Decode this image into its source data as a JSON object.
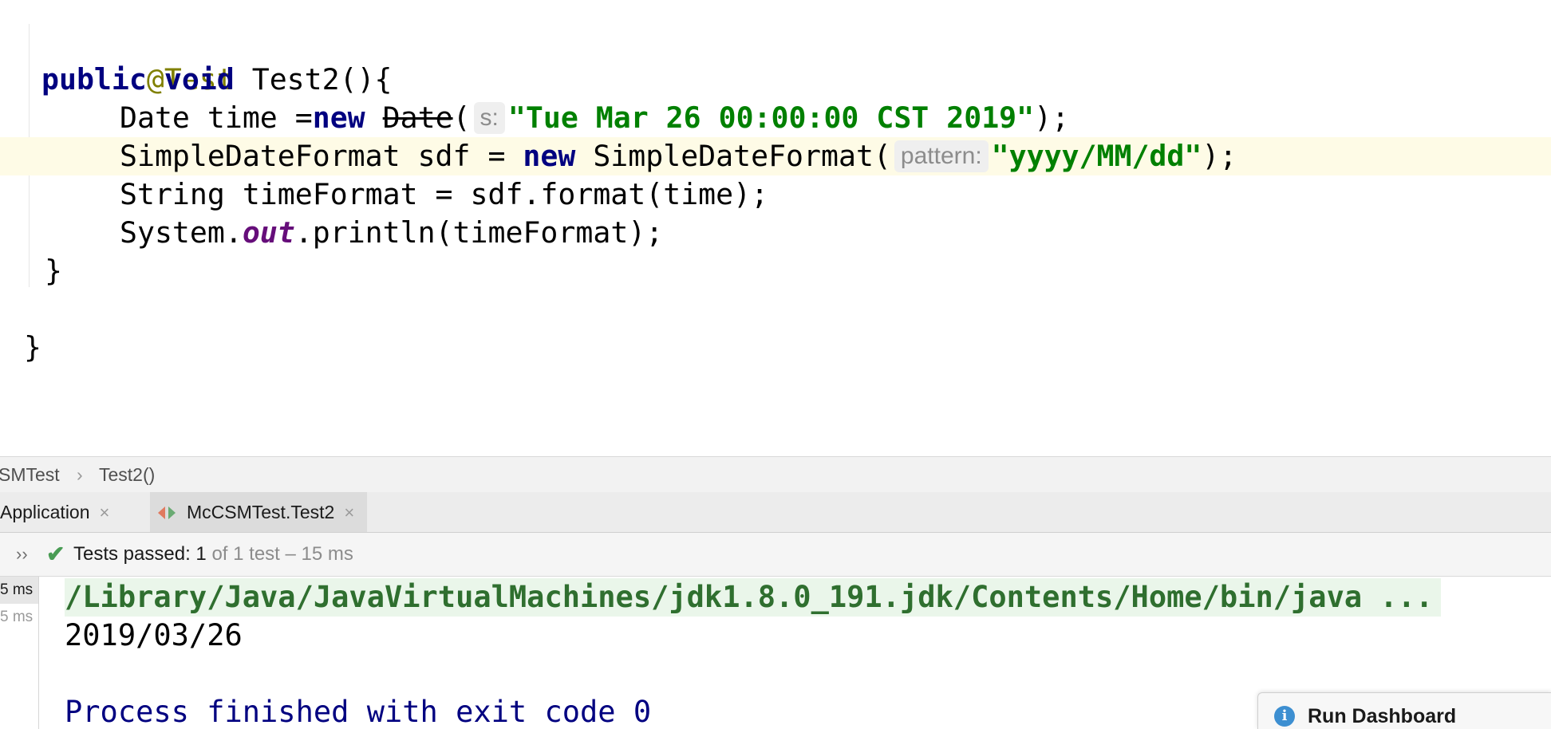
{
  "editor": {
    "annotation": "@Test",
    "method_kw_public": "public",
    "method_kw_void": "void",
    "method_sig": " Test2(){",
    "line3": {
      "prefix": "Date time =",
      "kw_new": "new",
      "deprecated_ctor": "Date",
      "paren": "(",
      "hint": "s:",
      "string": "\"Tue Mar 26 00:00:00 CST 2019\"",
      "suffix": ");"
    },
    "line4": {
      "prefix": "SimpleDateFormat sdf = ",
      "kw_new": "new",
      "ctor": " SimpleDateFormat(",
      "hint": "pattern:",
      "string": "\"yyyy/MM/dd\"",
      "suffix": ");"
    },
    "line5": "String timeFormat = sdf.format(time);",
    "line6": {
      "prefix": "System.",
      "field": "out",
      "suffix": ".println(timeFormat);"
    },
    "close_method": "}",
    "close_class": "}"
  },
  "breadcrumb": {
    "class": "SMTest",
    "separator": "›",
    "method": "Test2()"
  },
  "tabs": [
    {
      "label": "Application",
      "close": "×",
      "active": false
    },
    {
      "label": "McCSMTest.Test2",
      "close": "×",
      "active": true
    }
  ],
  "status": {
    "expand": "››",
    "check": "✔",
    "label": "Tests passed: ",
    "count": "1",
    "detail": " of 1 test – 15 ms"
  },
  "gutter": {
    "time1": "5 ms",
    "time2": "5 ms"
  },
  "console": {
    "command": "/Library/Java/JavaVirtualMachines/jdk1.8.0_191.jdk/Contents/Home/bin/java ...",
    "output": "2019/03/26",
    "finished": "Process finished with exit code 0"
  },
  "dashboard": {
    "icon": "info-icon",
    "label": "Run Dashboard"
  },
  "colors": {
    "keyword": "#000080",
    "annotation": "#808000",
    "string": "#008000",
    "field": "#660e7a",
    "current_line": "#fefbe6",
    "pass_green": "#499c54"
  }
}
